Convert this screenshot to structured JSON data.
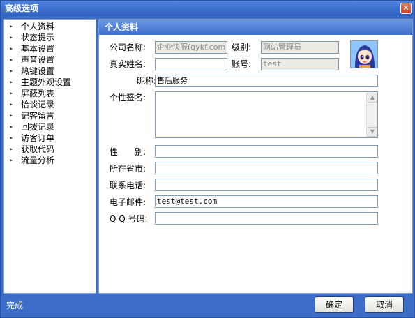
{
  "window": {
    "title": "高级选项",
    "close_glyph": "✕"
  },
  "sidebar": {
    "items": [
      {
        "label": "个人资料"
      },
      {
        "label": "状态提示"
      },
      {
        "label": "基本设置"
      },
      {
        "label": "声音设置"
      },
      {
        "label": "热键设置"
      },
      {
        "label": "主题外观设置"
      },
      {
        "label": "屏蔽列表"
      },
      {
        "label": "恰谈记录"
      },
      {
        "label": "记客留言"
      },
      {
        "label": "回拨记录"
      },
      {
        "label": "访客订单"
      },
      {
        "label": "获取代码"
      },
      {
        "label": "流量分析"
      }
    ]
  },
  "profile": {
    "header": "个人资料",
    "company_label": "公司名称:",
    "company_value": "企业快服(qykf.com",
    "level_label": "级别:",
    "level_value": "网站管理员",
    "realname_label": "真实姓名:",
    "realname_value": "",
    "account_label": "账号:",
    "account_value": "test",
    "nickname_label": "昵称:",
    "nickname_value": "售后服务",
    "signature_label": "个性签名:",
    "signature_value": "",
    "gender_label": "性　　别:",
    "gender_value": "",
    "province_label": "所在省市:",
    "province_value": "",
    "phone_label": "联系电话:",
    "phone_value": "",
    "email_label": "电子邮件:",
    "email_value": "test@test.com",
    "qq_label": "Q Q 号码:",
    "qq_value": ""
  },
  "status": {
    "text": "完成"
  },
  "buttons": {
    "ok": "确定",
    "cancel": "取消"
  },
  "icons": {
    "close": "close-icon",
    "arrow": "triangle-right-icon",
    "scroll_up": "scroll-up-icon",
    "scroll_down": "scroll-down-icon",
    "avatar": "avatar-cartoon-girl"
  },
  "colors": {
    "window_bg": "#3a6cc8",
    "header_bg": "#3e6fcc",
    "field_border": "#7f9db9",
    "disabled_bg": "#ebebe4"
  }
}
